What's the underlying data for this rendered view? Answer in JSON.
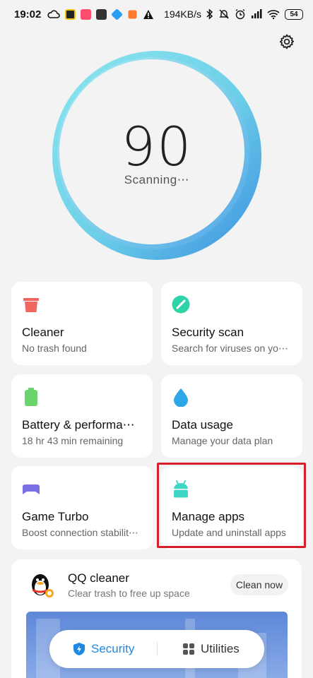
{
  "status_bar": {
    "time": "19:02",
    "speed": "194KB/s",
    "battery": "54"
  },
  "scan": {
    "score": "90",
    "status": "Scanning⋯"
  },
  "cards": [
    {
      "title": "Cleaner",
      "subtitle": "No trash found",
      "icon": "trash-icon",
      "color": "#f0675f"
    },
    {
      "title": "Security scan",
      "subtitle": "Search for viruses on yo⋯",
      "icon": "security-scan-icon",
      "color": "#2fd3a8"
    },
    {
      "title": "Battery & performa⋯",
      "subtitle": "18 hr 43 min  remaining",
      "icon": "battery-icon",
      "color": "#6bd36b"
    },
    {
      "title": "Data usage",
      "subtitle": "Manage your data plan",
      "icon": "water-drop-icon",
      "color": "#2ea7e8"
    },
    {
      "title": "Game Turbo",
      "subtitle": "Boost connection stabilit⋯",
      "icon": "gamepad-icon",
      "color": "#7b6fe6"
    },
    {
      "title": "Manage apps",
      "subtitle": "Update and uninstall apps",
      "icon": "android-app-icon",
      "color": "#3fd6c6"
    }
  ],
  "qq_cleaner": {
    "title": "QQ cleaner",
    "subtitle": "Clear trash to free up space",
    "button": "Clean now"
  },
  "bottom_nav": {
    "security": "Security",
    "utilities": "Utilities"
  },
  "colors": {
    "accent": "#1e88e5",
    "highlight": "#d3202a",
    "ring_light": "#7fe0ea",
    "ring_dark": "#3a8fe0"
  }
}
